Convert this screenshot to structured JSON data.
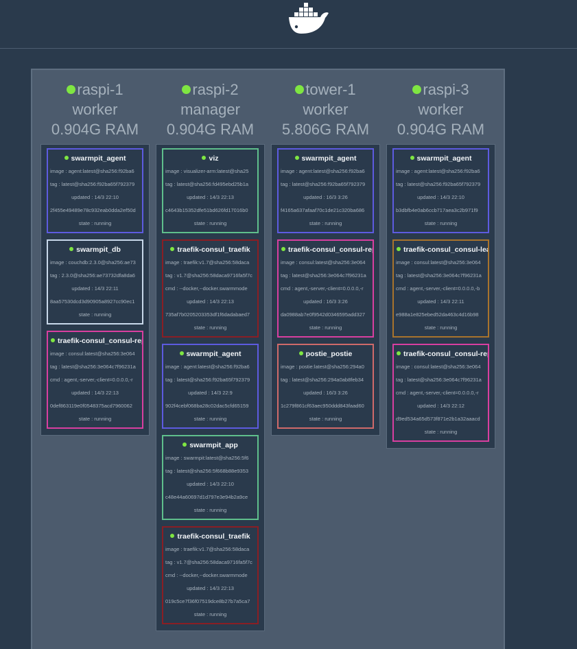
{
  "logo": "docker-whale-icon",
  "nodes": [
    {
      "name": "raspi-1",
      "role": "worker",
      "ram": "0.904G RAM",
      "services": [
        {
          "name": "swarmpit_agent",
          "color": "#5d5be0",
          "image": "image : agent:latest@sha256:f92ba6",
          "tag": "tag : latest@sha256:f92ba65f792379",
          "updated": "updated : 14/3 22:10",
          "hash": "2f455e49489e78c932eab0dda2ef50d",
          "state": "state : running"
        },
        {
          "name": "swarmpit_db",
          "color": "#c8d8ea",
          "image": "image : couchdb:2.3.0@sha256:ae73",
          "tag": "tag : 2.3.0@sha256:ae73732dfa8da6",
          "updated": "updated : 14/3 22:11",
          "hash": "8aa57530dcd3d90905a8927cc90ec1",
          "state": "state : running"
        },
        {
          "name": "traefik-consul_consul-repli",
          "color": "#d93fa0",
          "image": "image : consul:latest@sha256:3e064",
          "tag": "tag : latest@sha256:3e064c7f96231a",
          "cmd": "cmd : agent,-server,-client=0.0.0.0,-r",
          "updated": "updated : 14/3 22:13",
          "hash": "0def863119e0f0548375acd7960062",
          "state": "state : running"
        }
      ]
    },
    {
      "name": "raspi-2",
      "role": "manager",
      "ram": "0.904G RAM",
      "services": [
        {
          "name": "viz",
          "color": "#5fbf8c",
          "image": "image : visualizer-arm:latest@sha25",
          "tag": "tag : latest@sha256:fd495ebd25b1a",
          "updated": "updated : 14/3 22:13",
          "hash": "c4643b15352dfe51bd626fd17016b0",
          "state": "state : running"
        },
        {
          "name": "traefik-consul_traefik",
          "color": "#8a1e24",
          "image": "image : traefik:v1.7@sha256:58daca",
          "tag": "tag : v1.7@sha256:58daca9716fa5f7c",
          "cmd": "cmd : --docker,--docker.swarmmode",
          "updated": "updated : 14/3 22:13",
          "hash": "735af7b0205203353df1f6dadabaed7",
          "state": "state : running"
        },
        {
          "name": "swarmpit_agent",
          "color": "#5d5be0",
          "image": "image : agent:latest@sha256:f92ba6",
          "tag": "tag : latest@sha256:f92ba65f792379",
          "updated": "updated : 14/3 22:9",
          "hash": "902f4cebf068ba28c02dac5cfd65159",
          "state": "state : running"
        },
        {
          "name": "swarmpit_app",
          "color": "#5fbf8c",
          "image": "image : swarmpit:latest@sha256:5f6",
          "tag": "tag : latest@sha256:5f668b88e9353",
          "updated": "updated : 14/3 22:10",
          "hash": "c48e44a60697d1d797e3e94b2a9ce",
          "state": "state : running"
        },
        {
          "name": "traefik-consul_traefik",
          "color": "#8a1e24",
          "image": "image : traefik:v1.7@sha256:58daca",
          "tag": "tag : v1.7@sha256:58daca9716fa5f7c",
          "cmd": "cmd : --docker,--docker.swarmmode",
          "updated": "updated : 14/3 22:13",
          "hash": "019c5ce7f36f07519dce8b27b7a5ca7",
          "state": "state : running"
        }
      ]
    },
    {
      "name": "tower-1",
      "role": "worker",
      "ram": "5.806G RAM",
      "services": [
        {
          "name": "swarmpit_agent",
          "color": "#5d5be0",
          "image": "image : agent:latest@sha256:f92ba6",
          "tag": "tag : latest@sha256:f92ba65f792379",
          "updated": "updated : 16/3 3:26",
          "hash": "f4165a637afaaf70c1de21c320ba686",
          "state": "state : running"
        },
        {
          "name": "traefik-consul_consul-repli",
          "color": "#d93fa0",
          "image": "image : consul:latest@sha256:3e064",
          "tag": "tag : latest@sha256:3e064c7f96231a",
          "cmd": "cmd : agent,-server,-client=0.0.0.0,-r",
          "updated": "updated : 16/3 3:26",
          "hash": "da0988ab7e0f9542d0346595add327",
          "state": "state : running"
        },
        {
          "name": "postie_postie",
          "color": "#d06a6a",
          "image": "image : postie:latest@sha256:294a0",
          "tag": "tag : latest@sha256:294a0ab8feb34",
          "updated": "updated : 16/3 3:26",
          "hash": "1c279f861cf63aec950ddd843faad60",
          "state": "state : running"
        }
      ]
    },
    {
      "name": "raspi-3",
      "role": "worker",
      "ram": "0.904G RAM",
      "services": [
        {
          "name": "swarmpit_agent",
          "color": "#5d5be0",
          "image": "image : agent:latest@sha256:f92ba6",
          "tag": "tag : latest@sha256:f92ba65f792379",
          "updated": "updated : 14/3 22:10",
          "hash": "b3dbfb4e0ab6ccb717aea3c2b971f9",
          "state": "state : running"
        },
        {
          "name": "traefik-consul_consul-lead",
          "color": "#a9742c",
          "image": "image : consul:latest@sha256:3e064",
          "tag": "tag : latest@sha256:3e064c7f96231a",
          "cmd": "cmd : agent,-server,-client=0.0.0.0,-b",
          "updated": "updated : 14/3 22:11",
          "hash": "e988a1e825ebed52da463c4d16b98",
          "state": "state : running"
        },
        {
          "name": "traefik-consul_consul-repli",
          "color": "#d93fa0",
          "image": "image : consul:latest@sha256:3e064",
          "tag": "tag : latest@sha256:3e064c7f96231a",
          "cmd": "cmd : agent,-server,-client=0.0.0.0,-r",
          "updated": "updated : 14/3 22:12",
          "hash": "d9ed534a65d573f871e2b1a32aaacd",
          "state": "state : running"
        }
      ]
    }
  ]
}
